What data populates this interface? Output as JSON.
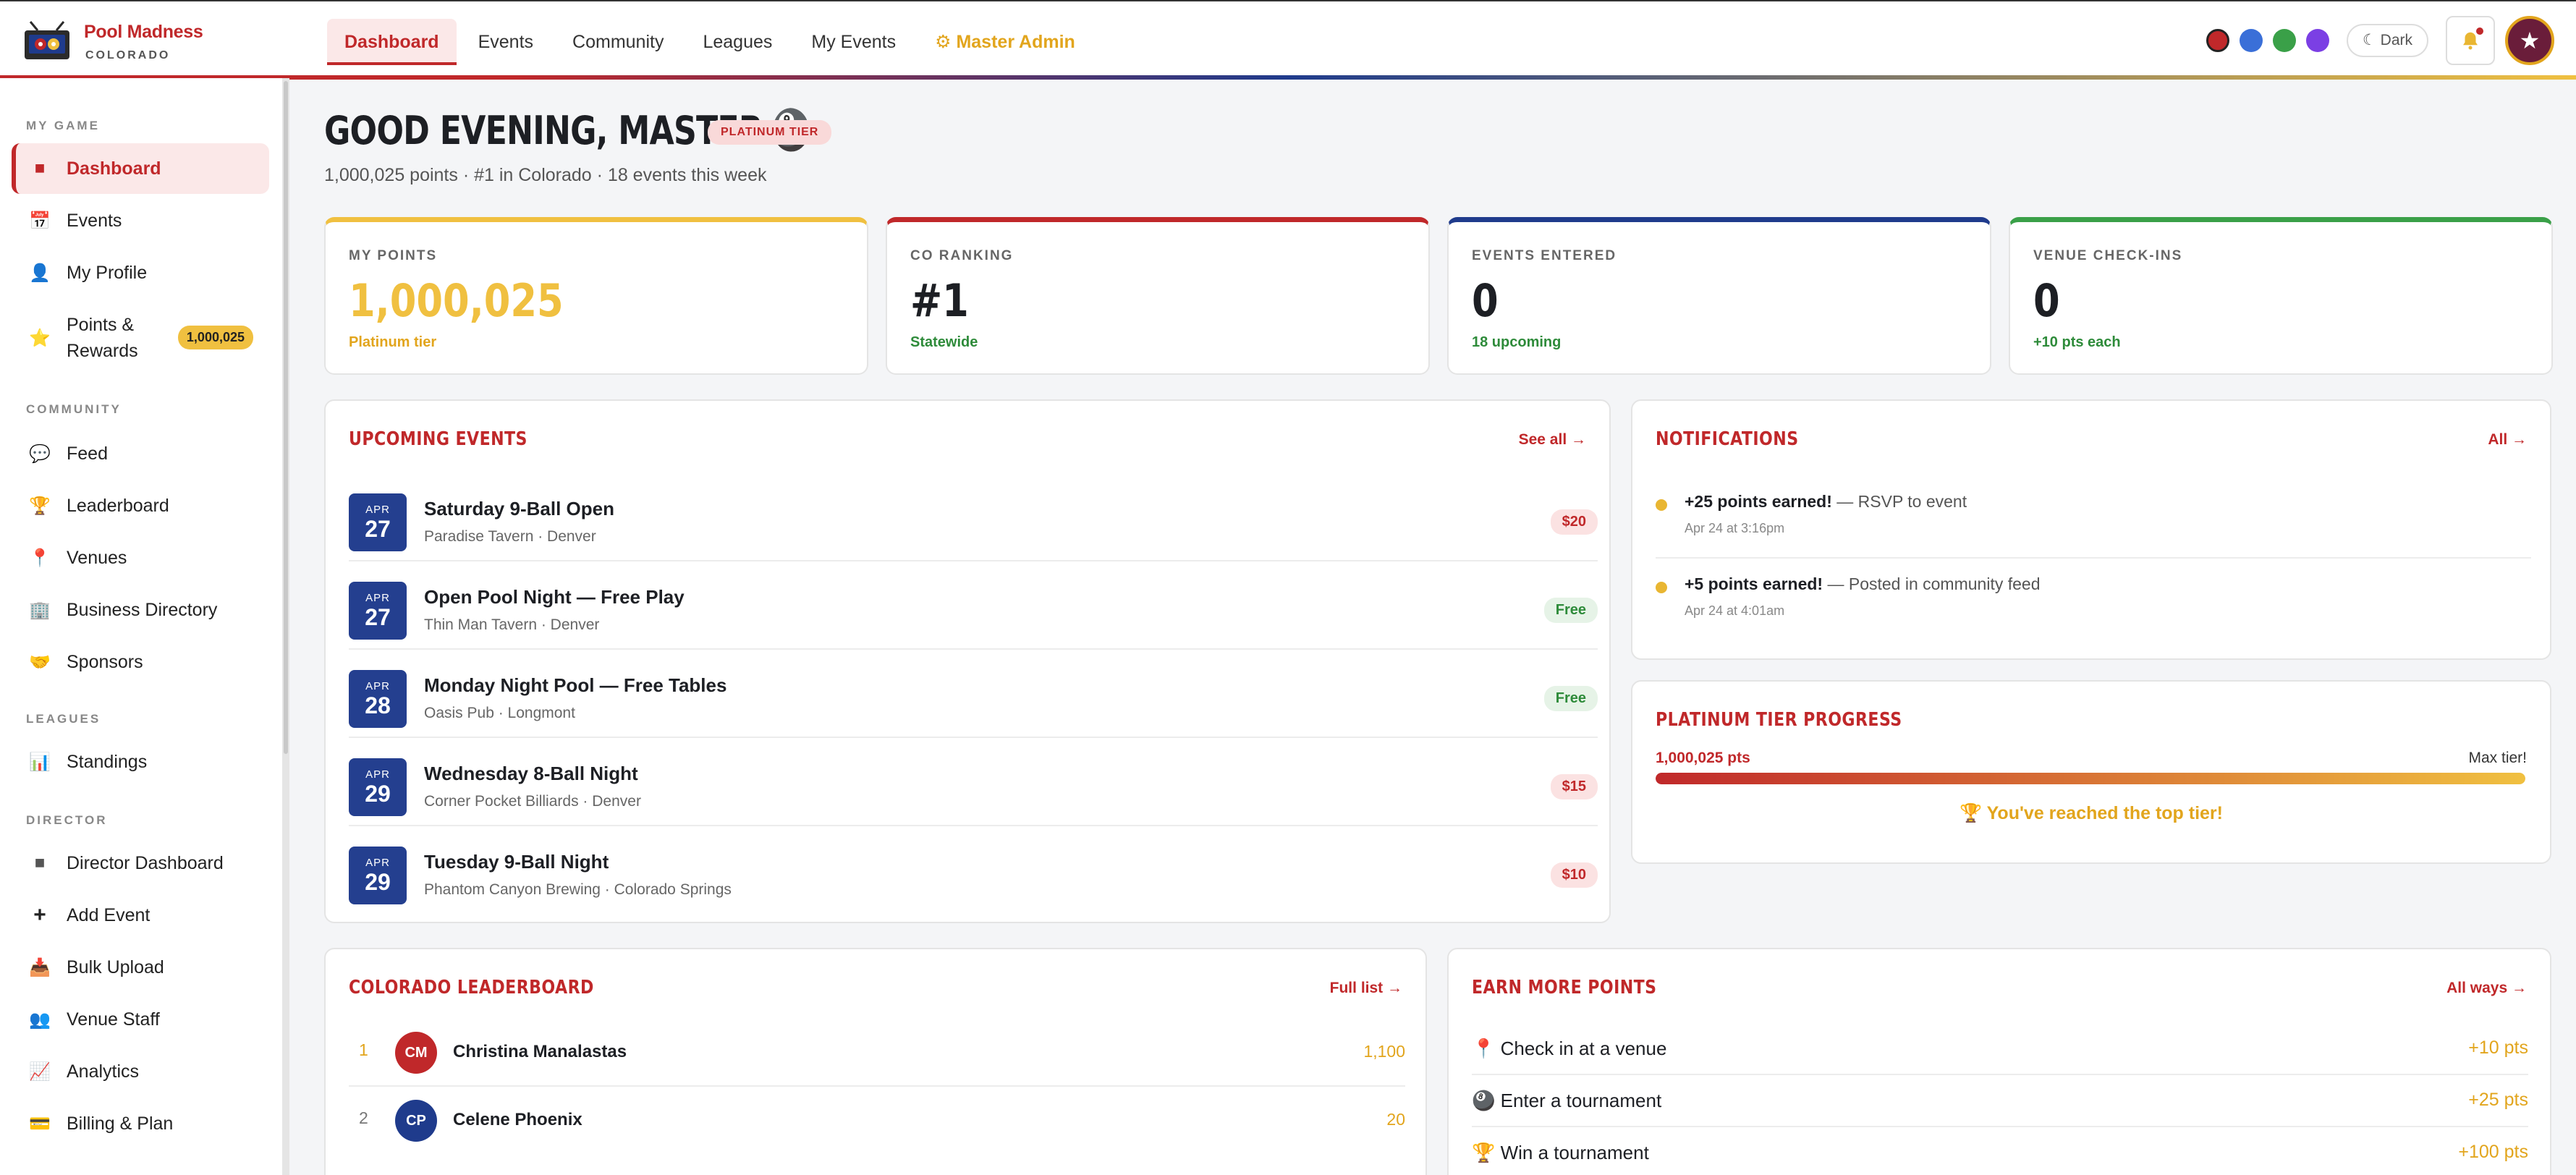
{
  "brand": {
    "name": "Pool Madness",
    "sub": "COLORADO"
  },
  "nav": [
    {
      "label": "Dashboard"
    },
    {
      "label": "Events"
    },
    {
      "label": "Community"
    },
    {
      "label": "Leagues"
    },
    {
      "label": "My Events"
    },
    {
      "label": "⚙ Master Admin"
    }
  ],
  "theme_swatches": [
    "#c0282a",
    "#3a6fd8",
    "#3aa048",
    "#7b3fe4"
  ],
  "dark_toggle": {
    "icon": "moon-icon",
    "label": "☾ Dark"
  },
  "avatar_icon": "★",
  "sidebar": {
    "sections": [
      {
        "title": "MY GAME",
        "items": [
          {
            "icon": "■",
            "label": "Dashboard"
          },
          {
            "icon": "📅",
            "label": "Events"
          },
          {
            "icon": "👤",
            "label": "My Profile"
          },
          {
            "icon": "⭐",
            "label": "Points &",
            "label2": "Rewards",
            "badge": "1,000,025"
          }
        ]
      },
      {
        "title": "COMMUNITY",
        "items": [
          {
            "icon": "💬",
            "label": "Feed"
          },
          {
            "icon": "🏆",
            "label": "Leaderboard"
          },
          {
            "icon": "📍",
            "label": "Venues"
          },
          {
            "icon": "🏢",
            "label": "Business Directory"
          },
          {
            "icon": "🤝",
            "label": "Sponsors"
          }
        ]
      },
      {
        "title": "LEAGUES",
        "items": [
          {
            "icon": "📊",
            "label": "Standings"
          }
        ]
      },
      {
        "title": "DIRECTOR",
        "items": [
          {
            "icon": "■",
            "label": "Director Dashboard"
          },
          {
            "icon": "+",
            "label": "Add Event"
          },
          {
            "icon": "📥",
            "label": "Bulk Upload"
          },
          {
            "icon": "👥",
            "label": "Venue Staff"
          },
          {
            "icon": "📈",
            "label": "Analytics"
          },
          {
            "icon": "💳",
            "label": "Billing & Plan"
          }
        ]
      }
    ]
  },
  "greeting": {
    "text": "GOOD EVENING, MASTER",
    "emoji": "🎱",
    "tier": "PLATINUM TIER"
  },
  "subline": "1,000,025 points  ·  #1 in Colorado  ·  18 events this week",
  "stats": [
    {
      "label": "MY POINTS",
      "value": "1,000,025",
      "foot": "Platinum tier",
      "accent": "#f0c040",
      "value_color": "#f0c040",
      "foot_color": "#e2a51d"
    },
    {
      "label": "CO RANKING",
      "value": "#1",
      "foot": "Statewide",
      "accent": "#c0282a",
      "value_color": "#1d1f24",
      "foot_color": "#2e8b3a"
    },
    {
      "label": "EVENTS ENTERED",
      "value": "0",
      "foot": "18 upcoming",
      "accent": "#1f3b8c",
      "value_color": "#1d1f24",
      "foot_color": "#2e8b3a"
    },
    {
      "label": "VENUE CHECK-INS",
      "value": "0",
      "foot": "+10 pts each",
      "accent": "#3aa048",
      "value_color": "#1d1f24",
      "foot_color": "#2e8b3a"
    }
  ],
  "upcoming": {
    "title": "UPCOMING EVENTS",
    "link": "See all →",
    "events": [
      {
        "mon": "APR",
        "day": "27",
        "title": "Saturday 9-Ball Open",
        "venue": "Paradise Tavern · Denver",
        "price": "$20",
        "free": false
      },
      {
        "mon": "APR",
        "day": "27",
        "title": "Open Pool Night — Free Play",
        "venue": "Thin Man Tavern · Denver",
        "price": "Free",
        "free": true
      },
      {
        "mon": "APR",
        "day": "28",
        "title": "Monday Night Pool — Free Tables",
        "venue": "Oasis Pub · Longmont",
        "price": "Free",
        "free": true
      },
      {
        "mon": "APR",
        "day": "29",
        "title": "Wednesday 8-Ball Night",
        "venue": "Corner Pocket Billiards · Denver",
        "price": "$15",
        "free": false
      },
      {
        "mon": "APR",
        "day": "29",
        "title": "Tuesday 9-Ball Night",
        "venue": "Phantom Canyon Brewing · Colorado Springs",
        "price": "$10",
        "free": false
      }
    ]
  },
  "notifications": {
    "title": "NOTIFICATIONS",
    "link": "All →",
    "items": [
      {
        "bold": "+25 points earned!",
        "rest": " — RSVP to event",
        "time": "Apr 24 at 3:16pm"
      },
      {
        "bold": "+5 points earned!",
        "rest": " — Posted in community feed",
        "time": "Apr 24 at 4:01am"
      }
    ]
  },
  "tier_progress": {
    "title": "PLATINUM TIER PROGRESS",
    "points": "1,000,025 pts",
    "max": "Max tier!",
    "progress": 1.0,
    "message": "🏆 You've reached the top tier!"
  },
  "leaderboard": {
    "title": "COLORADO LEADERBOARD",
    "link": "Full list →",
    "rows": [
      {
        "rank": "1",
        "initials": "CM",
        "name": "Christina Manalastas",
        "points": "1,100",
        "color": "#c0282a"
      },
      {
        "rank": "2",
        "initials": "CP",
        "name": "Celene Phoenix",
        "points": "20",
        "color": "#1f3b8c"
      }
    ]
  },
  "earn": {
    "title": "EARN MORE POINTS",
    "link": "All ways →",
    "rows": [
      {
        "label": "📍 Check in at a venue",
        "points": "+10 pts"
      },
      {
        "label": "🎱 Enter a tournament",
        "points": "+25 pts"
      },
      {
        "label": "🏆 Win a tournament",
        "points": "+100 pts"
      }
    ]
  }
}
